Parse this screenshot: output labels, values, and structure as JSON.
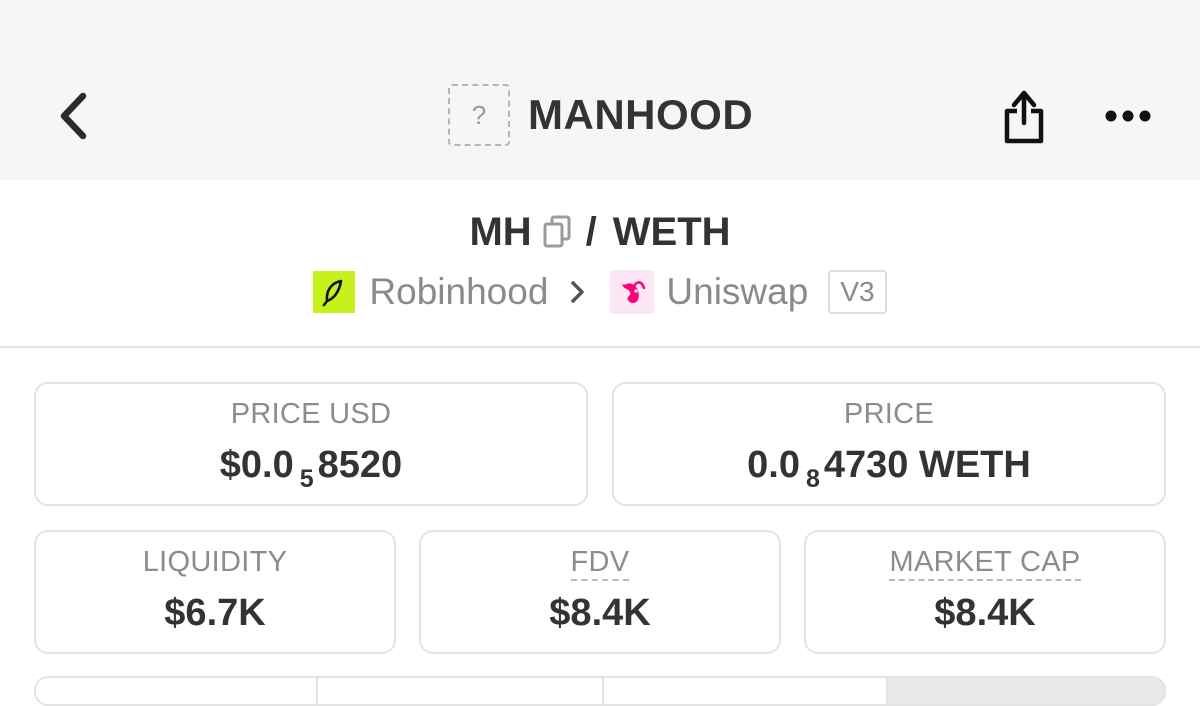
{
  "header": {
    "title": "MANHOOD",
    "token_placeholder": "?",
    "icons": {
      "back": "chevron-left-icon",
      "share": "share-icon",
      "more": "ellipsis-icon"
    }
  },
  "pair": {
    "base": "MH",
    "separator": "/",
    "quote": "WETH"
  },
  "source": {
    "chain": "Robinhood",
    "dex": "Uniswap",
    "version": "V3",
    "chain_color": "#c6f11b",
    "dex_color": "#ff007a"
  },
  "stats": {
    "price_usd": {
      "label": "PRICE USD",
      "prefix": "$0.0",
      "zeros": "5",
      "digits": "8520"
    },
    "price": {
      "label": "PRICE",
      "prefix": "0.0",
      "zeros": "8",
      "digits": "4730 WETH"
    },
    "liquidity": {
      "label": "LIQUIDITY",
      "value": "$6.7K"
    },
    "fdv": {
      "label": "FDV",
      "value": "$8.4K"
    },
    "market_cap": {
      "label": "MARKET CAP",
      "value": "$8.4K"
    }
  }
}
